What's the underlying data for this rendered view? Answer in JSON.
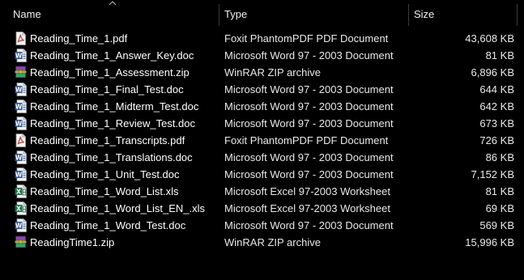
{
  "columns": {
    "name": "Name",
    "type": "Type",
    "size": "Size"
  },
  "files": [
    {
      "name": "Reading_Time_1.pdf",
      "type": "Foxit PhantomPDF PDF Document",
      "size": "43,608 KB",
      "icon": "pdf-icon"
    },
    {
      "name": "Reading_Time_1_Answer_Key.doc",
      "type": "Microsoft Word 97 - 2003 Document",
      "size": "81 KB",
      "icon": "word-doc-icon"
    },
    {
      "name": "Reading_Time_1_Assessment.zip",
      "type": "WinRAR ZIP archive",
      "size": "6,896 KB",
      "icon": "winrar-zip-icon"
    },
    {
      "name": "Reading_Time_1_Final_Test.doc",
      "type": "Microsoft Word 97 - 2003 Document",
      "size": "644 KB",
      "icon": "word-doc-icon"
    },
    {
      "name": "Reading_Time_1_Midterm_Test.doc",
      "type": "Microsoft Word 97 - 2003 Document",
      "size": "642 KB",
      "icon": "word-doc-icon"
    },
    {
      "name": "Reading_Time_1_Review_Test.doc",
      "type": "Microsoft Word 97 - 2003 Document",
      "size": "673 KB",
      "icon": "word-doc-icon"
    },
    {
      "name": "Reading_Time_1_Transcripts.pdf",
      "type": "Foxit PhantomPDF PDF Document",
      "size": "726 KB",
      "icon": "pdf-icon"
    },
    {
      "name": "Reading_Time_1_Translations.doc",
      "type": "Microsoft Word 97 - 2003 Document",
      "size": "86 KB",
      "icon": "word-doc-icon"
    },
    {
      "name": "Reading_Time_1_Unit_Test.doc",
      "type": "Microsoft Word 97 - 2003 Document",
      "size": "7,152 KB",
      "icon": "word-doc-icon"
    },
    {
      "name": "Reading_Time_1_Word_List.xls",
      "type": "Microsoft Excel 97-2003 Worksheet",
      "size": "81 KB",
      "icon": "excel-xls-icon"
    },
    {
      "name": "Reading_Time_1_Word_List_EN_.xls",
      "type": "Microsoft Excel 97-2003 Worksheet",
      "size": "69 KB",
      "icon": "excel-xls-icon"
    },
    {
      "name": "Reading_Time_1_Word_Test.doc",
      "type": "Microsoft Word 97 - 2003 Document",
      "size": "569 KB",
      "icon": "word-doc-icon"
    },
    {
      "name": "ReadingTime1.zip",
      "type": "WinRAR ZIP archive",
      "size": "15,996 KB",
      "icon": "winrar-zip-icon"
    }
  ],
  "colors": {
    "background": "#000000",
    "text": "#ffffff",
    "header_separator": "#3a3a3a",
    "word_blue": "#2b579a",
    "excel_green": "#1e7145",
    "pdf_red": "#c0392b",
    "zip_purple": "#7b3fa0"
  }
}
